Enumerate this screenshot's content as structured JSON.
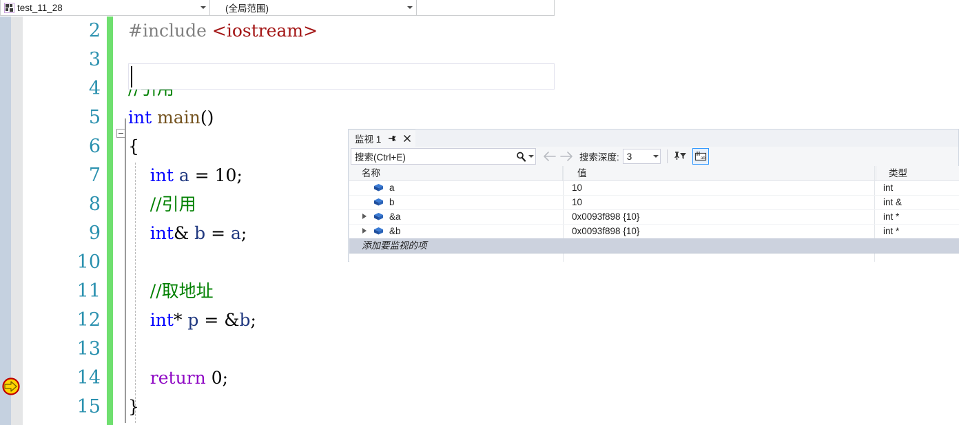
{
  "navbar": {
    "project_combo": {
      "label": "test_11_28",
      "icon": "project-file-icon"
    },
    "scope_combo": {
      "label": "(全局范围)"
    },
    "member_combo": {
      "label": ""
    }
  },
  "editor": {
    "first_visible_line": 2,
    "execution_line": 14,
    "current_line": 3,
    "lines": [
      {
        "no": "2",
        "segments": [
          {
            "t": "#include ",
            "c": "k-pre"
          },
          {
            "t": "<iostream>",
            "c": "k-str"
          }
        ]
      },
      {
        "no": "3",
        "segments": []
      },
      {
        "no": "4",
        "segments": [
          {
            "t": "//引用",
            "c": "k-cmt"
          }
        ]
      },
      {
        "no": "5",
        "segments": [
          {
            "t": "int",
            "c": "k-kw"
          },
          {
            "t": " ",
            "c": "k-pl"
          },
          {
            "t": "main",
            "c": "k-fn"
          },
          {
            "t": "()",
            "c": "k-pl"
          }
        ]
      },
      {
        "no": "6",
        "segments": [
          {
            "t": "{",
            "c": "k-pl"
          }
        ]
      },
      {
        "no": "7",
        "segments": [
          {
            "t": "    ",
            "c": "k-pl"
          },
          {
            "t": "int",
            "c": "k-kw"
          },
          {
            "t": " ",
            "c": "k-pl"
          },
          {
            "t": "a",
            "c": "k-id"
          },
          {
            "t": " = ",
            "c": "k-pl"
          },
          {
            "t": "10",
            "c": "k-num"
          },
          {
            "t": ";",
            "c": "k-pl"
          }
        ]
      },
      {
        "no": "8",
        "segments": [
          {
            "t": "    ",
            "c": "k-pl"
          },
          {
            "t": "//引用",
            "c": "k-cmt"
          }
        ]
      },
      {
        "no": "9",
        "segments": [
          {
            "t": "    ",
            "c": "k-pl"
          },
          {
            "t": "int",
            "c": "k-kw"
          },
          {
            "t": "& ",
            "c": "k-pl"
          },
          {
            "t": "b",
            "c": "k-id"
          },
          {
            "t": " = ",
            "c": "k-pl"
          },
          {
            "t": "a",
            "c": "k-id"
          },
          {
            "t": ";",
            "c": "k-pl"
          }
        ]
      },
      {
        "no": "10",
        "segments": []
      },
      {
        "no": "11",
        "segments": [
          {
            "t": "    ",
            "c": "k-pl"
          },
          {
            "t": "//取地址",
            "c": "k-cmt"
          }
        ]
      },
      {
        "no": "12",
        "segments": [
          {
            "t": "    ",
            "c": "k-pl"
          },
          {
            "t": "int",
            "c": "k-kw"
          },
          {
            "t": "* ",
            "c": "k-pl"
          },
          {
            "t": "p",
            "c": "k-id"
          },
          {
            "t": " = ",
            "c": "k-pl"
          },
          {
            "t": "&",
            "c": "k-pl"
          },
          {
            "t": "b",
            "c": "k-id"
          },
          {
            "t": ";",
            "c": "k-pl"
          }
        ]
      },
      {
        "no": "13",
        "segments": []
      },
      {
        "no": "14",
        "segments": [
          {
            "t": "    ",
            "c": "k-pl"
          },
          {
            "t": "return",
            "c": "k-ctl"
          },
          {
            "t": " ",
            "c": "k-pl"
          },
          {
            "t": "0",
            "c": "k-num"
          },
          {
            "t": ";",
            "c": "k-pl"
          }
        ]
      },
      {
        "no": "15",
        "segments": [
          {
            "t": "}",
            "c": "k-pl"
          }
        ]
      }
    ]
  },
  "watch": {
    "tab_title": "监视 1",
    "pin_icon": "pin-icon",
    "close_icon": "close-icon",
    "search_placeholder": "搜索(Ctrl+E)",
    "search_icon": "search-icon",
    "search_dropdown_icon": "chevron-down-icon",
    "back_icon": "arrow-left-icon",
    "forward_icon": "arrow-right-icon",
    "depth_label": "搜索深度:",
    "depth_value": "3",
    "toolbar_buttons": [
      {
        "name": "pin-filter-icon",
        "active": false
      },
      {
        "name": "hex-display-icon",
        "active": true
      }
    ],
    "columns": [
      "名称",
      "值",
      "类型"
    ],
    "rows": [
      {
        "name": "a",
        "value": "10",
        "type": "int",
        "expandable": false
      },
      {
        "name": "b",
        "value": "10",
        "type": "int &",
        "expandable": false
      },
      {
        "name": "&a",
        "value": "0x0093f898 {10}",
        "type": "int *",
        "expandable": true
      },
      {
        "name": "&b",
        "value": "0x0093f898 {10}",
        "type": "int *",
        "expandable": true
      }
    ],
    "add_row_placeholder": "添加要监视的项"
  },
  "colors": {
    "change_bar": "#6fdf6f",
    "line_number": "#2b91af",
    "keyword": "#0000ff",
    "comment": "#008000",
    "string": "#a31515",
    "control": "#8f08c4",
    "accent": "#3399ff",
    "selection": "#ccd2de"
  }
}
